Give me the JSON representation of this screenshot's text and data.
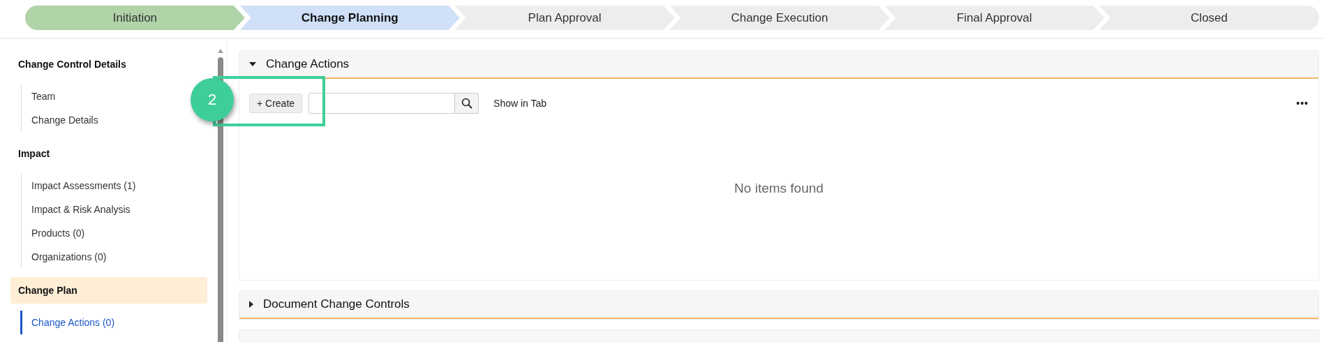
{
  "stepper": [
    {
      "label": "Initiation",
      "completed": true,
      "selected": false
    },
    {
      "label": "Change Planning",
      "completed": false,
      "selected": true
    },
    {
      "label": "Plan Approval",
      "completed": false,
      "selected": false
    },
    {
      "label": "Change Execution",
      "completed": false,
      "selected": false
    },
    {
      "label": "Final Approval",
      "completed": false,
      "selected": false
    },
    {
      "label": "Closed",
      "completed": false,
      "selected": false
    }
  ],
  "sidebar": {
    "sections": [
      {
        "title": "Change Control Details",
        "selected": false,
        "items": [
          {
            "label": "Team",
            "selected": false
          },
          {
            "label": "Change Details",
            "selected": false
          }
        ]
      },
      {
        "title": "Impact",
        "selected": false,
        "items": [
          {
            "label": "Impact Assessments (1)",
            "selected": false
          },
          {
            "label": "Impact & Risk Analysis",
            "selected": false
          },
          {
            "label": "Products (0)",
            "selected": false
          },
          {
            "label": "Organizations (0)",
            "selected": false
          }
        ]
      },
      {
        "title": "Change Plan",
        "selected": true,
        "items": [
          {
            "label": "Change Actions (0)",
            "selected": true
          }
        ]
      }
    ]
  },
  "panels": [
    {
      "title": "Change Actions",
      "expanded": true,
      "toolbar": {
        "create_button": "+ Create",
        "show_in_tab": "Show in Tab",
        "more_button": "•••"
      },
      "empty_message": "No items found"
    },
    {
      "title": "Document Change Controls",
      "expanded": false
    }
  ],
  "callout": {
    "number": "2"
  }
}
